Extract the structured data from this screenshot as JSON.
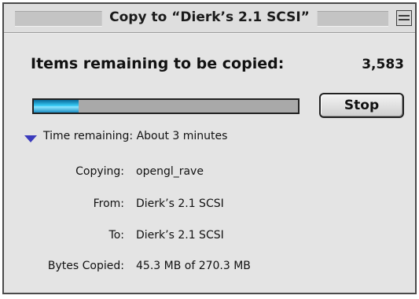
{
  "window": {
    "title": "Copy to “Dierk’s 2.1 SCSI”"
  },
  "status": {
    "items_label": "Items remaining to be copied:",
    "items_count": "3,583",
    "progress_fraction": 0.17,
    "progress_color": "#35c9f4"
  },
  "buttons": {
    "stop_label": "Stop"
  },
  "details": {
    "disclosure_icon": "triangle-down-icon",
    "time_remaining": "Time remaining: About 3 minutes",
    "copying_label": "Copying:",
    "copying_value": "opengl_rave",
    "from_label": "From:",
    "from_value": "Dierk’s 2.1 SCSI",
    "to_label": "To:",
    "to_value": "Dierk’s 2.1 SCSI",
    "bytes_label": "Bytes Copied:",
    "bytes_value": "45.3 MB of 270.3 MB"
  },
  "colors": {
    "window_bg": "#e4e4e4",
    "accent_triangle": "#3b3bbd"
  }
}
